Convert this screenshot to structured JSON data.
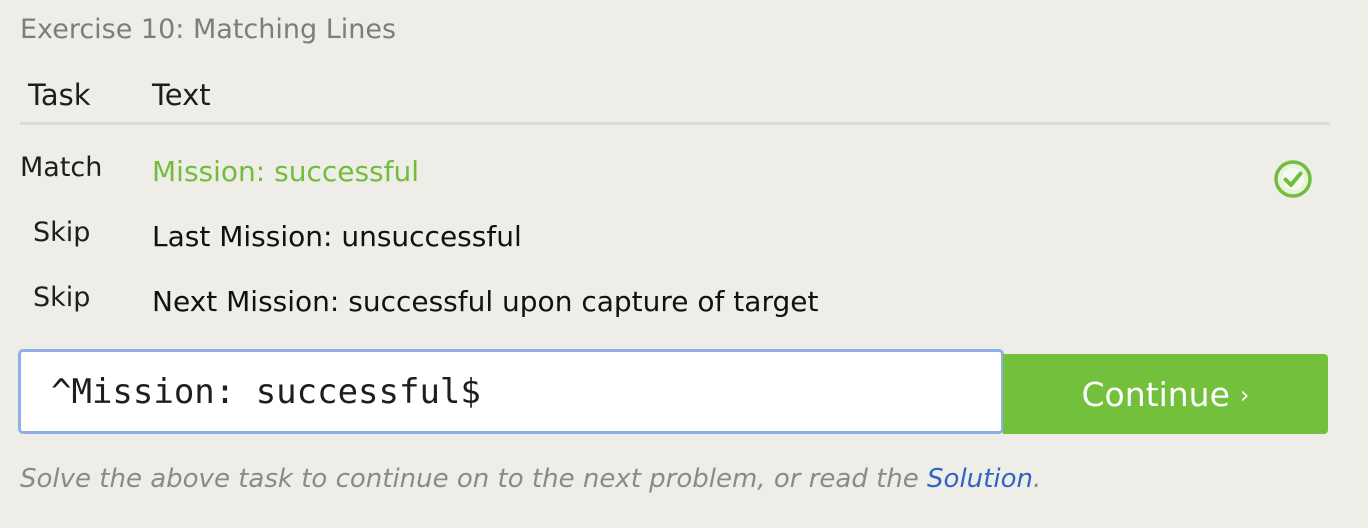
{
  "exercise": {
    "title": "Exercise 10: Matching Lines"
  },
  "table": {
    "headers": {
      "task": "Task",
      "text": "Text"
    },
    "rows": [
      {
        "task": "Match",
        "text": "Mission: successful",
        "status": "matched"
      },
      {
        "task": "Skip",
        "text": "Last Mission: unsuccessful",
        "status": "none"
      },
      {
        "task": "Skip",
        "text": "Next Mission: successful upon capture of target",
        "status": "none"
      }
    ]
  },
  "input": {
    "value": "^Mission: successful$"
  },
  "continue_button": {
    "label": "Continue",
    "chevron": "›"
  },
  "hint": {
    "prefix": "Solve the above task to continue on to the next problem, or read the ",
    "link_text": "Solution",
    "suffix": "."
  },
  "colors": {
    "accent_green": "#72c03c",
    "match_text": "#72bd3b",
    "link_blue": "#2d66c3",
    "input_focus_border": "#8fb0e6"
  },
  "icons": {
    "match_status": "check-circle-icon"
  }
}
